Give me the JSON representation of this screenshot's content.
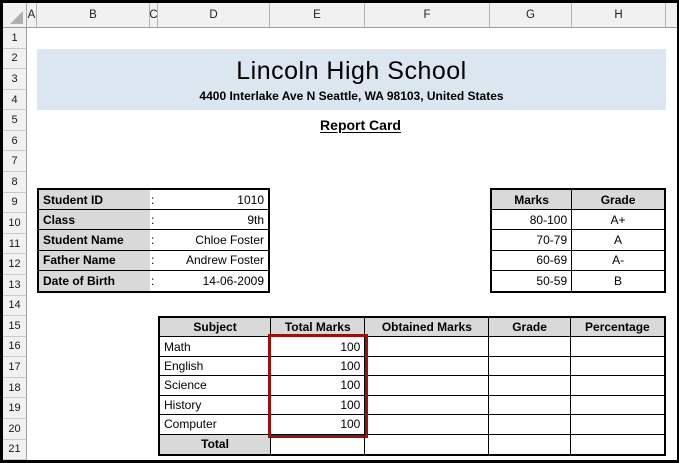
{
  "sheet": {
    "column_headers": [
      "A",
      "B",
      "C",
      "D",
      "E",
      "F",
      "G",
      "H"
    ],
    "row_headers": [
      "1",
      "2",
      "3",
      "4",
      "5",
      "6",
      "7",
      "8",
      "9",
      "10",
      "11",
      "12",
      "13",
      "14",
      "15",
      "16",
      "17",
      "18",
      "19",
      "20",
      "21"
    ]
  },
  "header_banner": {
    "school_name": "Lincoln High School",
    "address": "4400 Interlake Ave N Seattle, WA 98103, United States"
  },
  "report_title": "Report Card",
  "student_info": {
    "rows": [
      {
        "label": "Student ID",
        "separator": ":",
        "value": "1010"
      },
      {
        "label": "Class",
        "separator": ":",
        "value": "9th"
      },
      {
        "label": "Student Name",
        "separator": ":",
        "value": "Chloe Foster"
      },
      {
        "label": "Father Name",
        "separator": ":",
        "value": "Andrew Foster"
      },
      {
        "label": "Date of Birth",
        "separator": ":",
        "value": "14-06-2009"
      }
    ]
  },
  "grade_scale": {
    "headers": {
      "marks": "Marks",
      "grade": "Grade"
    },
    "rows": [
      {
        "marks": "80-100",
        "grade": "A+"
      },
      {
        "marks": "70-79",
        "grade": "A"
      },
      {
        "marks": "60-69",
        "grade": "A-"
      },
      {
        "marks": "50-59",
        "grade": "B"
      }
    ]
  },
  "marks_table": {
    "headers": [
      "Subject",
      "Total Marks",
      "Obtained Marks",
      "Grade",
      "Percentage"
    ],
    "rows": [
      {
        "subject": "Math",
        "total_marks": "100",
        "obtained_marks": "",
        "grade": "",
        "percentage": ""
      },
      {
        "subject": "English",
        "total_marks": "100",
        "obtained_marks": "",
        "grade": "",
        "percentage": ""
      },
      {
        "subject": "Science",
        "total_marks": "100",
        "obtained_marks": "",
        "grade": "",
        "percentage": ""
      },
      {
        "subject": "History",
        "total_marks": "100",
        "obtained_marks": "",
        "grade": "",
        "percentage": ""
      },
      {
        "subject": "Computer",
        "total_marks": "100",
        "obtained_marks": "",
        "grade": "",
        "percentage": ""
      }
    ],
    "footer": {
      "label": "Total",
      "total_marks": "",
      "obtained_marks": "",
      "grade": "",
      "percentage": ""
    }
  },
  "colors": {
    "banner_bg": "#dce6f1",
    "cell_fill": "#d9d9d9",
    "highlight_border": "#9c0f0f"
  }
}
